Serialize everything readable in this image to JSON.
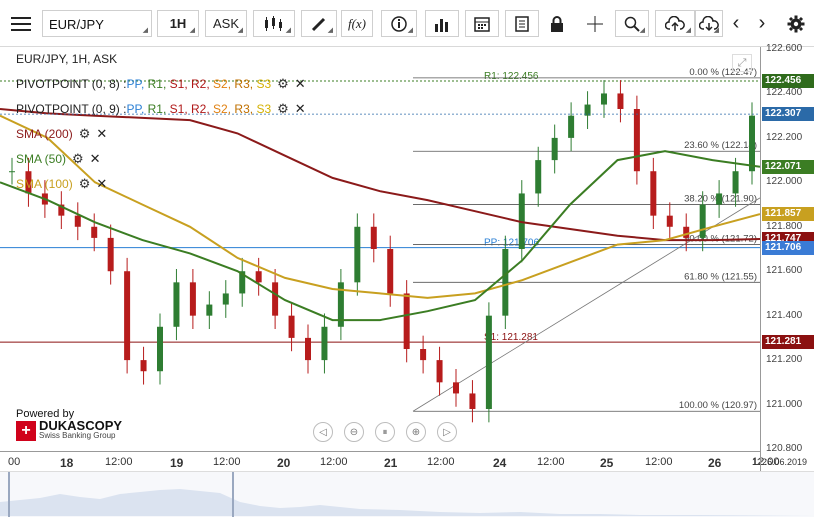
{
  "toolbar": {
    "symbol": "EUR/JPY",
    "timeframe": "1H",
    "price_side": "ASK",
    "fx_label": "f(x)"
  },
  "legend": {
    "title": "EUR/JPY, 1H, ASK",
    "pivot1": {
      "name": "PIVOTPOINT (0, 8)"
    },
    "pivot2": {
      "name": "PIVOTPOINT (0, 9)"
    },
    "pp": "PP,",
    "r1": "R1,",
    "s1": "S1,",
    "r2": "R2,",
    "s2": "S2,",
    "r3": "R3,",
    "s3": "S3",
    "sma200": "SMA (200)",
    "sma50": "SMA (50)",
    "sma100": "SMA (100)"
  },
  "branding": {
    "powered": "Powered by",
    "name": "DUKASCOPY",
    "sub": "Swiss Banking Group"
  },
  "chart_data": {
    "type": "candlestick",
    "symbol": "EUR/JPY",
    "timeframe": "1H",
    "ylim": [
      120.8,
      122.6
    ],
    "y_ticks": [
      "122.600",
      "122.400",
      "122.200",
      "122.000",
      "121.800",
      "121.600",
      "121.400",
      "121.200",
      "121.000",
      "120.800"
    ],
    "x_ticks": [
      "00",
      "18",
      "12:00",
      "19",
      "12:00",
      "20",
      "12:00",
      "21",
      "12:00",
      "24",
      "12:00",
      "25",
      "12:00",
      "26",
      "12:00",
      "1226.06.2019"
    ],
    "pivot_lines": [
      {
        "label": "R1: 122.456",
        "value": 122.456,
        "color": "#3b7d23"
      },
      {
        "label": "PP: 121.706",
        "value": 121.706,
        "color": "#2a7fd4"
      },
      {
        "label": "S1: 121.281",
        "value": 121.281,
        "color": "#8b1010"
      }
    ],
    "fibonacci": [
      {
        "label": "0.00 % (122.47)",
        "value": 122.47
      },
      {
        "label": "23.60 % (122.14)",
        "value": 122.14
      },
      {
        "label": "38.20 % (121.90)",
        "value": 121.9
      },
      {
        "label": "50.00 % (121.72)",
        "value": 121.72
      },
      {
        "label": "61.80 % (121.55)",
        "value": 121.55
      },
      {
        "label": "100.00 % (120.97)",
        "value": 120.97
      }
    ],
    "price_tags": [
      {
        "text": "122.456",
        "value": 122.456,
        "color": "#2f6b1c"
      },
      {
        "text": "122.307",
        "value": 122.307,
        "color": "#2b6aa8"
      },
      {
        "text": "122.071",
        "value": 122.071,
        "color": "#3b7d23"
      },
      {
        "text": "121.857",
        "value": 121.857,
        "color": "#c8a020"
      },
      {
        "text": "121.747",
        "value": 121.747,
        "color": "#8b1010"
      },
      {
        "text": "121.706",
        "value": 121.706,
        "color": "#3a7bd5"
      },
      {
        "text": "121.281",
        "value": 121.281,
        "color": "#8b1010"
      }
    ],
    "sma200": [
      122.33,
      122.31,
      122.3,
      122.29,
      122.28,
      122.22,
      122.12,
      122.02,
      121.96,
      121.92,
      121.87,
      121.82,
      121.79,
      121.76,
      121.74,
      121.74,
      121.745
    ],
    "sma50": [
      122.0,
      121.92,
      121.82,
      121.74,
      121.68,
      121.6,
      121.47,
      121.38,
      121.38,
      121.42,
      121.47,
      121.65,
      121.9,
      122.1,
      122.14,
      122.1,
      122.07
    ],
    "sma100": [
      122.3,
      122.2,
      122.0,
      121.9,
      121.8,
      121.66,
      121.57,
      121.52,
      121.5,
      121.48,
      121.5,
      121.56,
      121.64,
      121.72,
      121.74,
      121.8,
      121.857
    ],
    "candles": [
      122.05,
      121.95,
      121.9,
      121.85,
      121.8,
      121.75,
      121.6,
      121.2,
      121.15,
      121.35,
      121.55,
      121.4,
      121.45,
      121.5,
      121.6,
      121.55,
      121.4,
      121.3,
      121.2,
      121.35,
      121.55,
      121.8,
      121.7,
      121.5,
      121.25,
      121.2,
      121.1,
      121.05,
      120.98,
      121.4,
      121.7,
      121.95,
      122.1,
      122.2,
      122.3,
      122.35,
      122.4,
      122.33,
      122.05,
      121.85,
      121.8,
      121.75,
      121.9,
      121.95,
      122.05,
      122.3
    ]
  }
}
